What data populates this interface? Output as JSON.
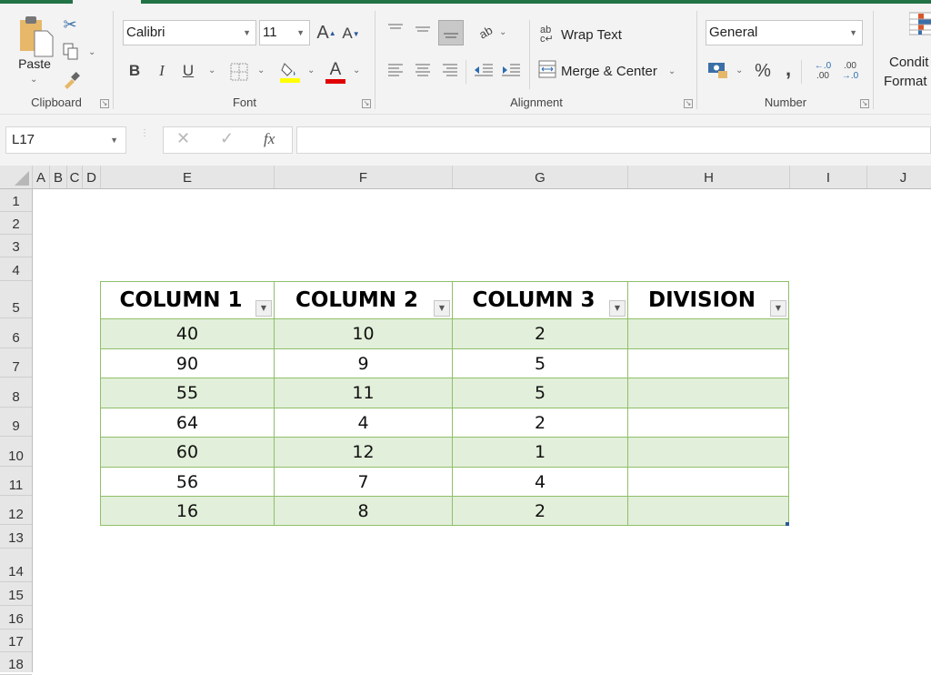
{
  "ribbon": {
    "clipboard": {
      "label": "Clipboard",
      "paste_label": "Paste",
      "icons": [
        "paste-icon",
        "cut-icon",
        "copy-icon",
        "format-painter-icon"
      ]
    },
    "font": {
      "label": "Font",
      "font_name": "Calibri",
      "font_size": "11",
      "bold": "B",
      "italic": "I",
      "underline": "U",
      "grow": "A",
      "shrink": "A",
      "fill_color": "#ffff00",
      "font_color": "#e00000",
      "font_color_letter": "A"
    },
    "alignment": {
      "label": "Alignment",
      "wrap_text": "Wrap Text",
      "merge_center": "Merge & Center"
    },
    "number": {
      "label": "Number",
      "format": "General",
      "percent": "%",
      "comma": ",",
      "inc_decimal_top": "←.0",
      "inc_decimal_bottom": ".00",
      "dec_decimal_top": ".00",
      "dec_decimal_bottom": "→.0"
    },
    "styles": {
      "conditional_line1": "Condit",
      "conditional_line2": "Format"
    }
  },
  "formula_bar": {
    "name_box": "L17",
    "cancel": "✕",
    "enter": "✓",
    "fx": "fx",
    "value": ""
  },
  "columns": [
    "A",
    "B",
    "C",
    "D",
    "E",
    "F",
    "G",
    "H",
    "I",
    "J"
  ],
  "rows": [
    "1",
    "2",
    "3",
    "4",
    "5",
    "6",
    "7",
    "8",
    "9",
    "10",
    "11",
    "12",
    "13",
    "14",
    "15",
    "16",
    "17",
    "18"
  ],
  "table": {
    "headers": [
      "COLUMN 1",
      "COLUMN 2",
      "COLUMN 3",
      "DIVISION"
    ],
    "rows": [
      [
        "40",
        "10",
        "2",
        ""
      ],
      [
        "90",
        "9",
        "5",
        ""
      ],
      [
        "55",
        "11",
        "5",
        ""
      ],
      [
        "64",
        "4",
        "2",
        ""
      ],
      [
        "60",
        "12",
        "1",
        ""
      ],
      [
        "56",
        "7",
        "4",
        ""
      ],
      [
        "16",
        "8",
        "2",
        ""
      ]
    ],
    "band_color": "#e2efda",
    "border_color": "#8fbf6a"
  },
  "theme": {
    "accent": "#217346"
  }
}
